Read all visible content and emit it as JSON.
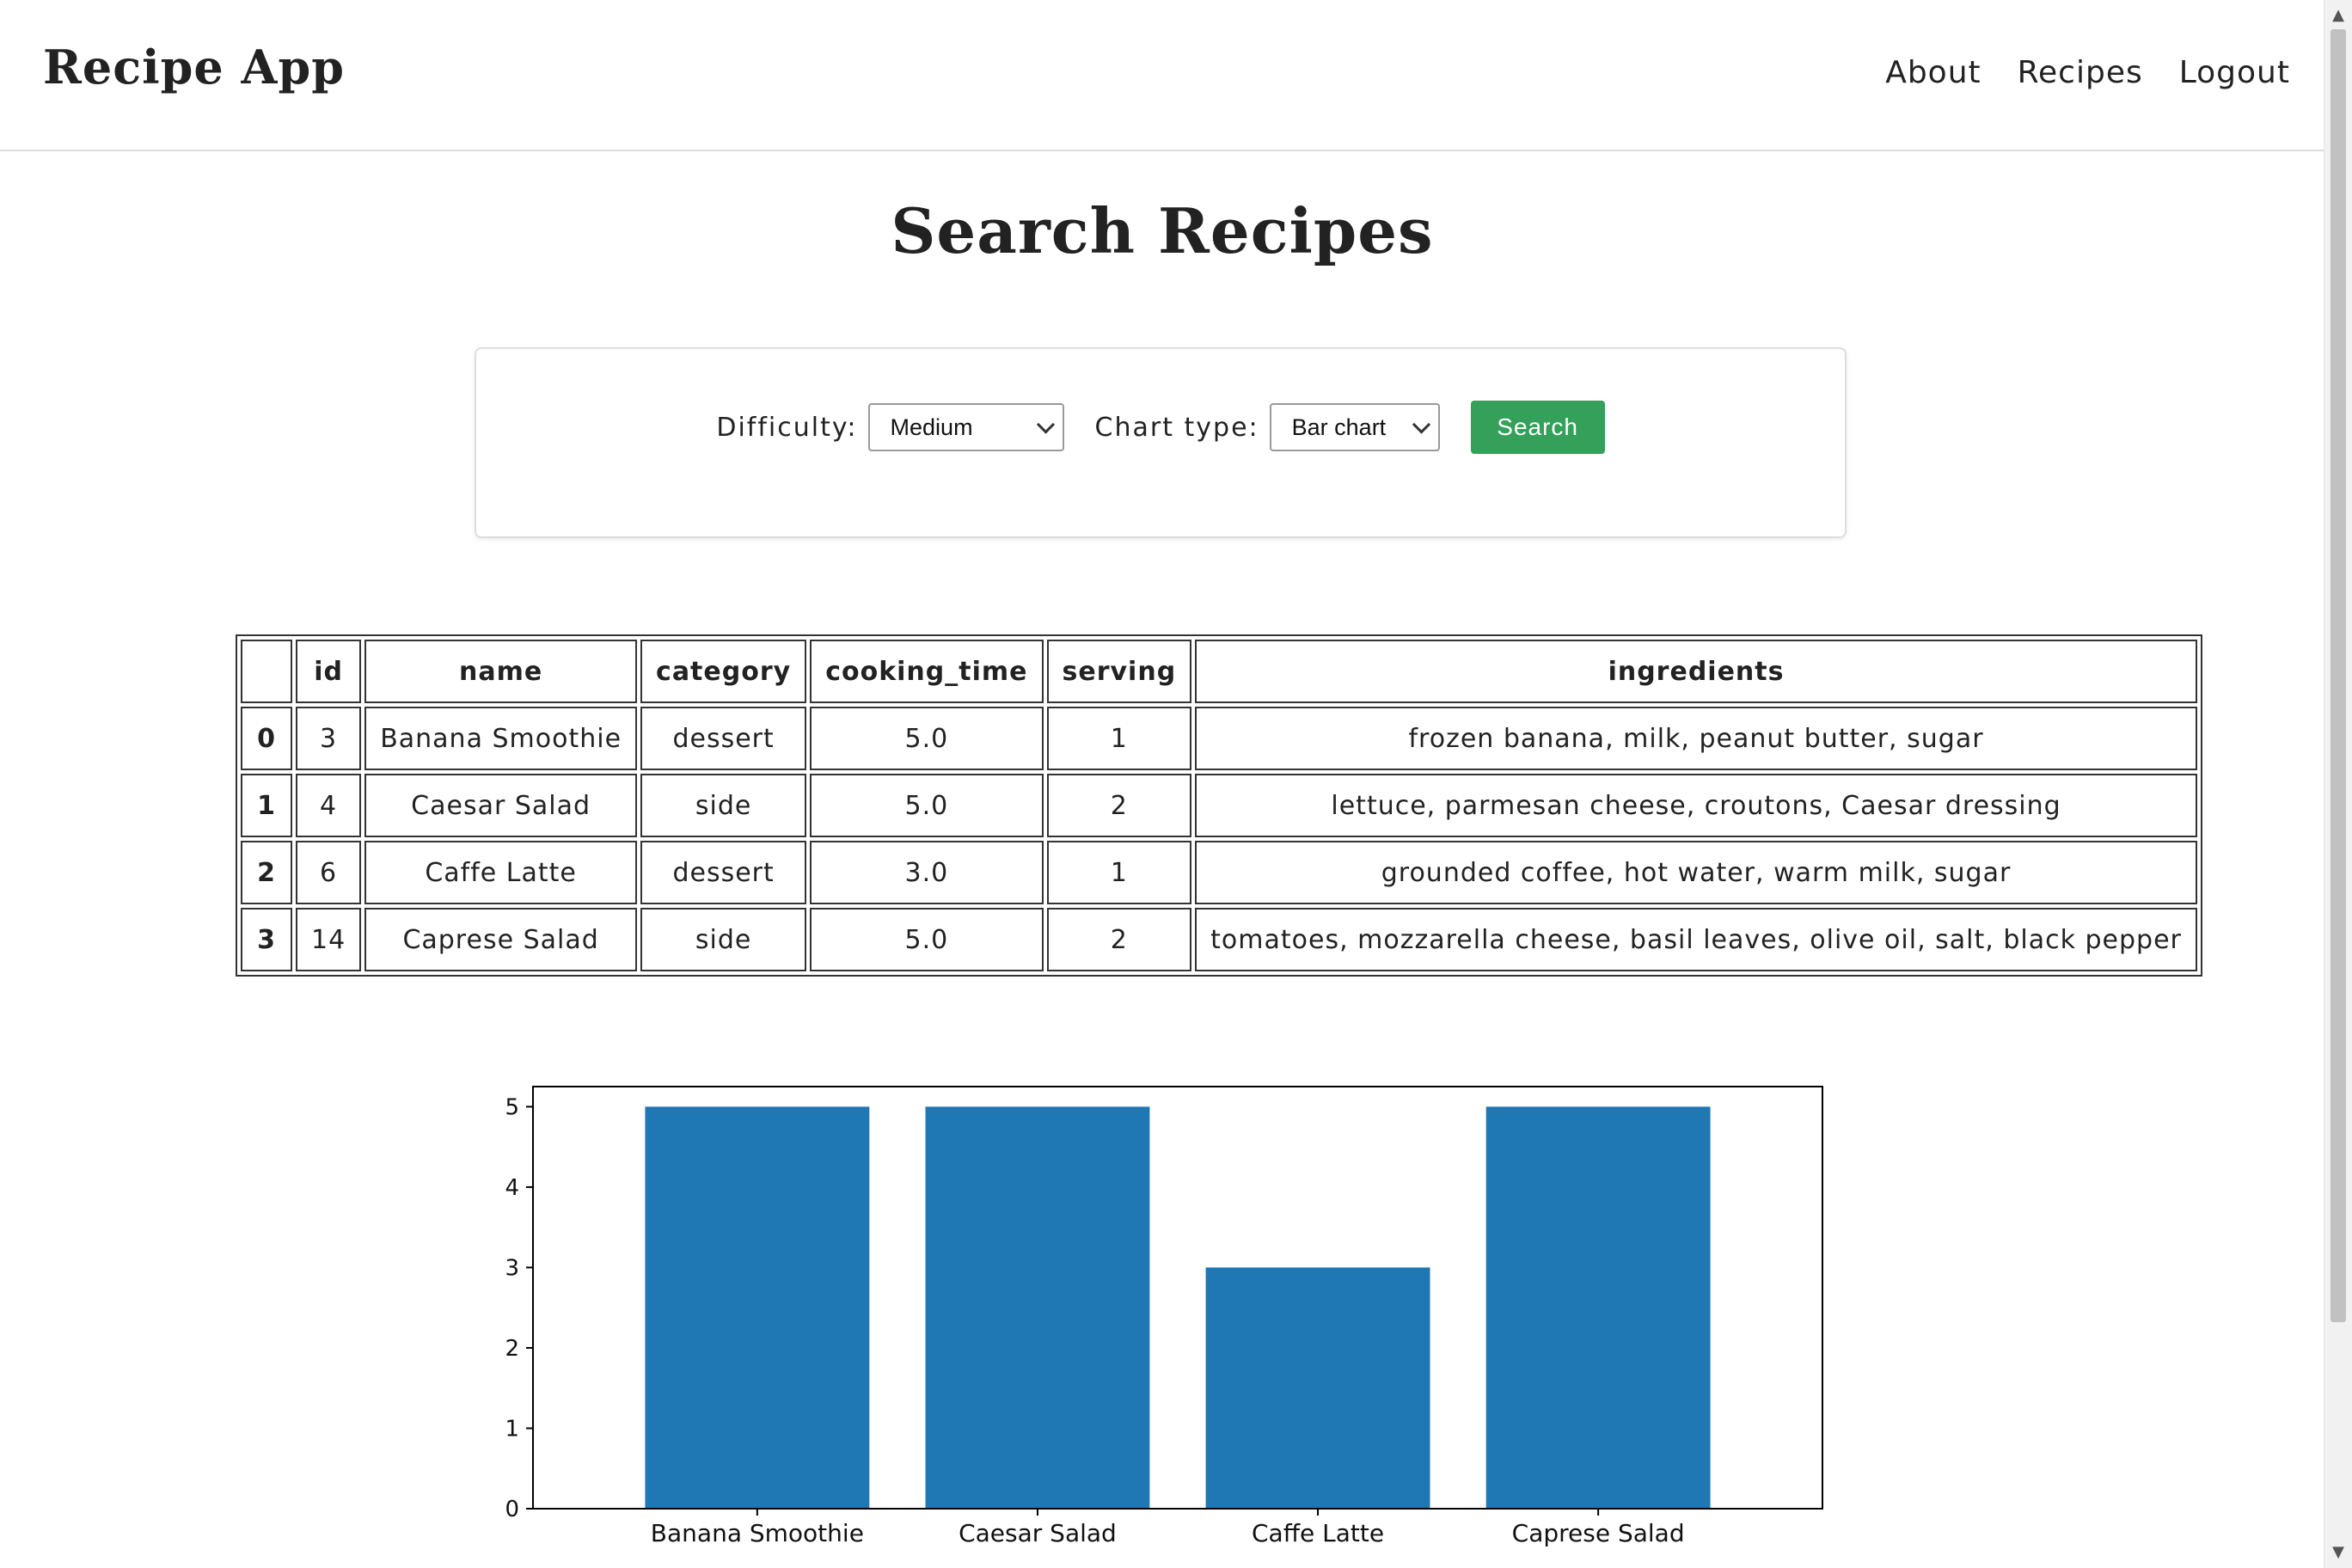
{
  "app": {
    "brand": "Recipe App"
  },
  "nav": {
    "items": [
      "About",
      "Recipes",
      "Logout"
    ]
  },
  "page": {
    "title": "Search Recipes"
  },
  "search_form": {
    "difficulty_label": "Difficulty:",
    "difficulty_value": "Medium",
    "chart_type_label": "Chart type:",
    "chart_type_value": "Bar chart",
    "search_button": "Search",
    "button_color": "#34a05a"
  },
  "table": {
    "columns": [
      "",
      "id",
      "name",
      "category",
      "cooking_time",
      "serving",
      "ingredients"
    ],
    "rows": [
      [
        "0",
        "3",
        "Banana Smoothie",
        "dessert",
        "5.0",
        "1",
        "frozen banana, milk, peanut butter, sugar"
      ],
      [
        "1",
        "4",
        "Caesar Salad",
        "side",
        "5.0",
        "2",
        "lettuce, parmesan cheese, croutons, Caesar dressing"
      ],
      [
        "2",
        "6",
        "Caffe Latte",
        "dessert",
        "3.0",
        "1",
        "grounded coffee, hot water, warm milk, sugar"
      ],
      [
        "3",
        "14",
        "Caprese Salad",
        "side",
        "5.0",
        "2",
        "tomatoes, mozzarella cheese, basil leaves, olive oil, salt, black pepper"
      ]
    ]
  },
  "chart_data": {
    "type": "bar",
    "categories": [
      "Banana Smoothie",
      "Caesar Salad",
      "Caffe Latte",
      "Caprese Salad"
    ],
    "values": [
      5.0,
      5.0,
      3.0,
      5.0
    ],
    "title": "",
    "xlabel": "",
    "ylabel": "",
    "ylim": [
      0,
      5.25
    ],
    "yticks": [
      "0",
      "1",
      "2",
      "3",
      "4",
      "5"
    ],
    "bar_color": "#1f77b4",
    "grid": false,
    "legend": "none"
  }
}
